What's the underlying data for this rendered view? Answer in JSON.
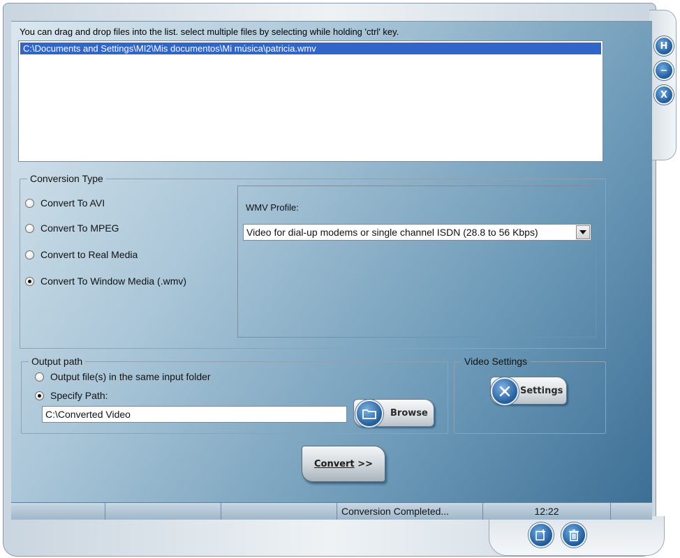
{
  "instruction": "You can drag and drop files into the list. select multiple files by selecting while holding 'ctrl' key.",
  "file_list": {
    "items": [
      "C:\\Documents and Settings\\MI2\\Mis documentos\\Mi música\\patricia.wmv"
    ],
    "selected_index": 0
  },
  "conversion_type": {
    "legend": "Conversion Type",
    "options": [
      {
        "label": "Convert To AVI",
        "selected": false
      },
      {
        "label": "Convert To MPEG",
        "selected": false
      },
      {
        "label": "Convert to Real Media",
        "selected": false
      },
      {
        "label": "Convert To Window Media (.wmv)",
        "selected": true
      }
    ]
  },
  "wmv_profile": {
    "label": "WMV Profile:",
    "selected": "Video for dial-up modems or single channel ISDN (28.8 to 56 Kbps)"
  },
  "output_path": {
    "legend": "Output path",
    "options": [
      {
        "label": "Output file(s) in the same input folder",
        "selected": false
      },
      {
        "label": "Specify Path:",
        "selected": true
      }
    ],
    "path_value": "C:\\Converted Video",
    "browse_label": "Browse"
  },
  "video_settings": {
    "legend": "Video Settings",
    "settings_label": "Settings"
  },
  "convert_label": "Convert",
  "convert_suffix": ">>",
  "window_buttons": {
    "help": "H",
    "minimize": "−",
    "close": "X"
  },
  "statusbar": {
    "cells": [
      "",
      "",
      "",
      "Conversion Completed...",
      "12:22",
      ""
    ]
  },
  "colors": {
    "selection": "#3166c8",
    "panel_dark": "#3d6f95",
    "panel_light": "#dbe7ef"
  }
}
